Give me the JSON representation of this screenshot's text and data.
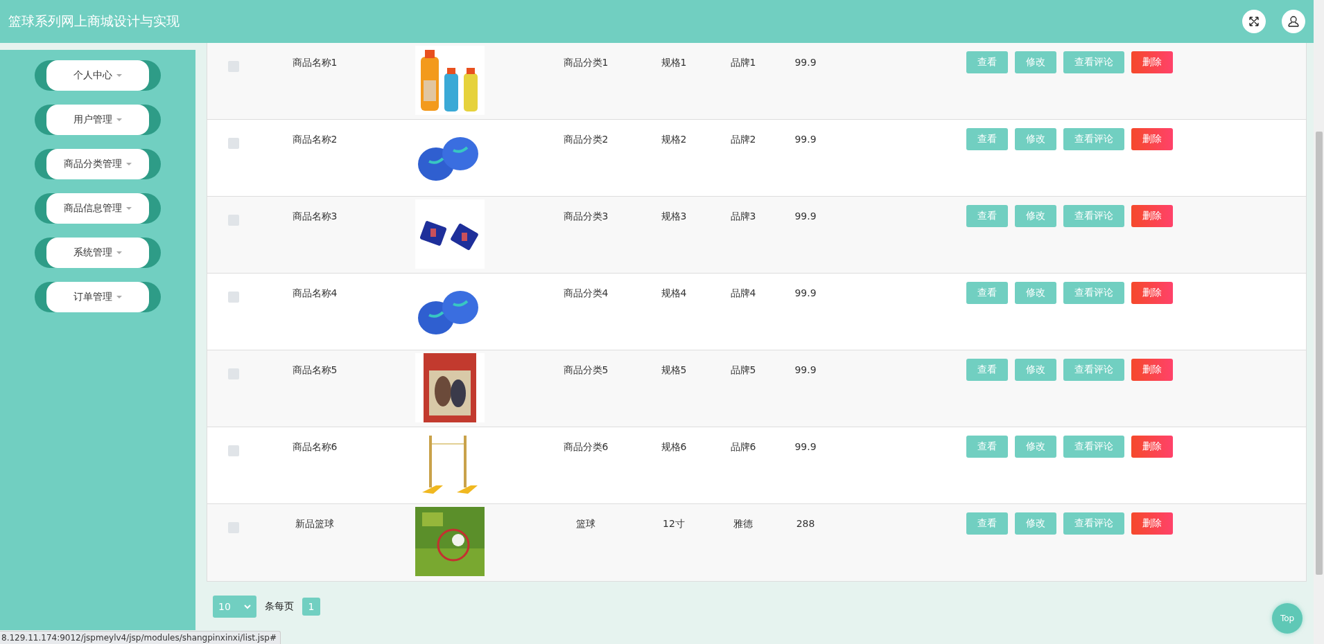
{
  "header": {
    "title": "篮球系列网上商城设计与实现"
  },
  "sidebar": {
    "items": [
      {
        "label": "个人中心"
      },
      {
        "label": "用户管理"
      },
      {
        "label": "商品分类管理"
      },
      {
        "label": "商品信息管理"
      },
      {
        "label": "系统管理"
      },
      {
        "label": "订单管理"
      }
    ]
  },
  "table": {
    "rows": [
      {
        "checked": false,
        "name": "商品名称1",
        "category": "商品分类1",
        "spec": "规格1",
        "brand": "品牌1",
        "price": "99.9",
        "actions": [
          {
            "label": "查看",
            "kind": "normal"
          },
          {
            "label": "修改",
            "kind": "normal"
          },
          {
            "label": "查看评论",
            "kind": "normal"
          },
          {
            "label": "删除",
            "kind": "danger"
          }
        ]
      },
      {
        "checked": false,
        "name": "商品名称2",
        "category": "商品分类2",
        "spec": "规格2",
        "brand": "品牌2",
        "price": "99.9",
        "actions": [
          {
            "label": "查看",
            "kind": "normal"
          },
          {
            "label": "修改",
            "kind": "normal"
          },
          {
            "label": "查看评论",
            "kind": "normal"
          },
          {
            "label": "删除",
            "kind": "danger"
          }
        ]
      },
      {
        "checked": false,
        "name": "商品名称3",
        "category": "商品分类3",
        "spec": "规格3",
        "brand": "品牌3",
        "price": "99.9",
        "actions": [
          {
            "label": "查看",
            "kind": "normal"
          },
          {
            "label": "修改",
            "kind": "normal"
          },
          {
            "label": "查看评论",
            "kind": "normal"
          },
          {
            "label": "删除",
            "kind": "danger"
          }
        ]
      },
      {
        "checked": false,
        "name": "商品名称4",
        "category": "商品分类4",
        "spec": "规格4",
        "brand": "品牌4",
        "price": "99.9",
        "actions": [
          {
            "label": "查看",
            "kind": "normal"
          },
          {
            "label": "修改",
            "kind": "normal"
          },
          {
            "label": "查看评论",
            "kind": "normal"
          },
          {
            "label": "删除",
            "kind": "danger"
          }
        ]
      },
      {
        "checked": false,
        "name": "商品名称5",
        "category": "商品分类5",
        "spec": "规格5",
        "brand": "品牌5",
        "price": "99.9",
        "actions": [
          {
            "label": "查看",
            "kind": "normal"
          },
          {
            "label": "修改",
            "kind": "normal"
          },
          {
            "label": "查看评论",
            "kind": "normal"
          },
          {
            "label": "删除",
            "kind": "danger"
          }
        ]
      },
      {
        "checked": false,
        "name": "商品名称6",
        "category": "商品分类6",
        "spec": "规格6",
        "brand": "品牌6",
        "price": "99.9",
        "actions": [
          {
            "label": "查看",
            "kind": "normal"
          },
          {
            "label": "修改",
            "kind": "normal"
          },
          {
            "label": "查看评论",
            "kind": "normal"
          },
          {
            "label": "删除",
            "kind": "danger"
          }
        ]
      },
      {
        "checked": false,
        "name": "新品篮球",
        "category": "篮球",
        "spec": "12寸",
        "brand": "雅德",
        "price": "288",
        "actions": [
          {
            "label": "查看",
            "kind": "normal"
          },
          {
            "label": "修改",
            "kind": "normal"
          },
          {
            "label": "查看评论",
            "kind": "normal"
          },
          {
            "label": "删除",
            "kind": "danger"
          }
        ]
      }
    ]
  },
  "pagination": {
    "page_size": "10",
    "per_page_label": "条每页",
    "pages": [
      {
        "label": "1",
        "selected": true
      }
    ]
  },
  "back_to_top": "Top",
  "status_bar": {
    "url": "8.129.11.174:9012/jspmeylv4/jsp/modules/shangpinxinxi/list.jsp#"
  }
}
